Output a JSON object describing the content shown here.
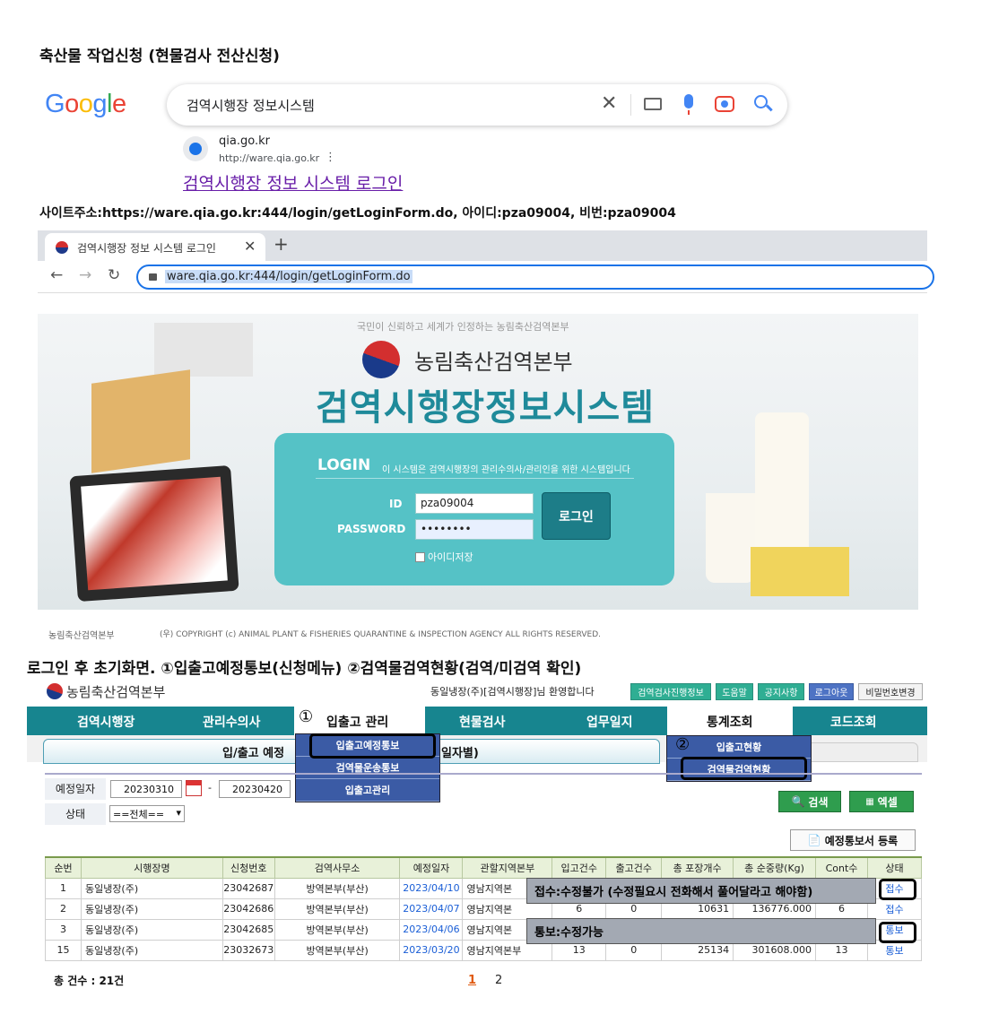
{
  "heading": "축산물 작업신청 (현물검사 전산신청)",
  "google": {
    "logo": [
      "G",
      "o",
      "o",
      "g",
      "l",
      "e"
    ],
    "logo_colors": [
      "#4285f4",
      "#ea4335",
      "#fbbc05",
      "#4285f4",
      "#34a853",
      "#ea4335"
    ],
    "query": "검역시행장 정보시스템",
    "clear": "✕",
    "result": {
      "site": "qia.go.kr",
      "url": "http://ware.qia.go.kr",
      "more": "⋮",
      "title": "검역시행장 정보 시스템 로그인"
    }
  },
  "siteinfo": "사이트주소:https://ware.qia.go.kr:444/login/getLoginForm.do, 아이디:pza09004, 비번:pza09004",
  "browser": {
    "tab_title": "검역시행장 정보 시스템 로그인",
    "tab_close": "✕",
    "new_tab": "+",
    "back": "←",
    "forward": "→",
    "reload": "↻",
    "address": "ware.qia.go.kr:444/login/getLoginForm.do"
  },
  "login_page": {
    "slogan": "국민이 신뢰하고 세계가 인정하는 농림축산검역본부",
    "agency": "농림축산검역본부",
    "system_title": "검역시행장정보시스템",
    "login_heading": "LOGIN",
    "login_desc": "이 시스템은 검역시행장의 관리수의사/관리인을 위한 시스템입니다",
    "id_label": "ID",
    "id_value": "pza09004",
    "pw_label": "PASSWORD",
    "pw_value": "••••••••",
    "login_button": "로그인",
    "remember_label": "아이디저장",
    "footer_logo": "농림축산검역본부",
    "footer_copy": "(우) COPYRIGHT (c) ANIMAL PLANT & FISHERIES QUARANTINE & INSPECTION AGENCY ALL RIGHTS RESERVED."
  },
  "section2": "로그인 후 초기화면. ①입출고예정통보(신청메뉴) ②검역물검역현황(검역/미검역 확인)",
  "app": {
    "agency": "농림축산검역본부",
    "welcome": "동일냉장(주)[검역시행장]님 환영합니다",
    "top_buttons": [
      "검역검사진행정보",
      "도움말",
      "공지사항",
      "로그아웃",
      "비밀번호변경"
    ],
    "menu": [
      "검역시행장",
      "관리수의사",
      "입출고 관리",
      "현물검사",
      "업무일지",
      "통계조회",
      "코드조회"
    ],
    "sub_tab_left": "입/출고 예정",
    "sub_tab_right": "일자별)",
    "dropdown1": [
      "입출고예정통보",
      "검역물운송통보",
      "입출고관리"
    ],
    "dropdown2": [
      "입출고현황",
      "검역물검역현황"
    ],
    "marker1": "①",
    "marker2": "②",
    "filter": {
      "date_label": "예정일자",
      "date_from": "20230310",
      "date_sep": "-",
      "date_to": "20230420",
      "status_label": "상태",
      "status_value": "==전체==",
      "search_button": "검색",
      "excel_button": "엑셀"
    },
    "register_button": "예정통보서 등록",
    "columns": [
      "순번",
      "시행장명",
      "신청번호",
      "검역사무소",
      "예정일자",
      "관할지역본부",
      "입고건수",
      "출고건수",
      "총 포장개수",
      "총 순중량(Kg)",
      "Cont수",
      "상태"
    ],
    "rows": [
      [
        "1",
        "동일냉장(주)",
        "23042687",
        "방역본부(부산)",
        "2023/04/10",
        "영남지역본",
        "",
        "",
        "",
        "",
        "",
        "접수"
      ],
      [
        "2",
        "동일냉장(주)",
        "23042686",
        "방역본부(부산)",
        "2023/04/07",
        "영남지역본",
        "6",
        "0",
        "10631",
        "136776.000",
        "6",
        "접수"
      ],
      [
        "3",
        "동일냉장(주)",
        "23042685",
        "방역본부(부산)",
        "2023/04/06",
        "영남지역본",
        "",
        "",
        "",
        "",
        "",
        "통보"
      ],
      [
        "15",
        "동일냉장(주)",
        "23032673",
        "방역본부(부산)",
        "2023/03/20",
        "영남지역본부",
        "13",
        "0",
        "25134",
        "301608.000",
        "13",
        "통보"
      ]
    ],
    "note_receipt": "접수:수정불가 (수정필요시 전화해서 풀어달라고 해야함)",
    "note_notify": "통보:수정가능",
    "total": "총 건수 : 21건",
    "pages": [
      "1",
      "2"
    ]
  },
  "colors": {
    "teal_menu": "#17858f",
    "login_box": "#55c2c6",
    "dropdown": "#3b5ba5",
    "link": "#1a5ed6"
  }
}
